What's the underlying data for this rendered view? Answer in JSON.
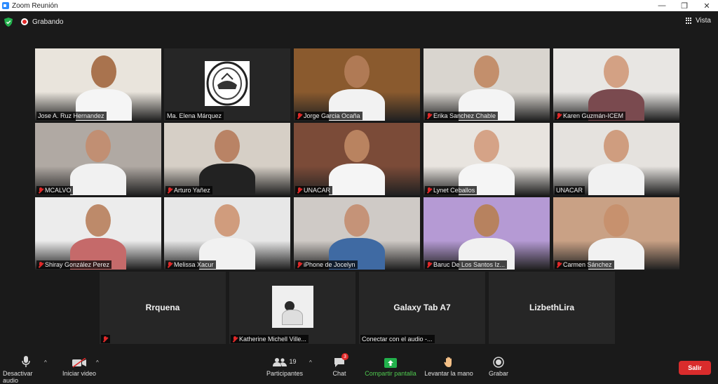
{
  "window": {
    "title": "Zoom Reunión",
    "minimize": "—",
    "maximize": "❐",
    "close": "✕"
  },
  "meeting": {
    "recording_label": "Grabando",
    "view_label": "Vista"
  },
  "participants": [
    {
      "name": "Jose A. Ruz Hernandez",
      "muted": false,
      "bg": "#e9e4dc",
      "skin": "#a9734e",
      "shirt": "#f5f5f5"
    },
    {
      "name": "Ma. Elena Márquez",
      "muted": false,
      "bg": "#262626",
      "skin": "#ffffff",
      "shirt": "#ffffff"
    },
    {
      "name": "Jorge Garcia Ocaña",
      "muted": true,
      "bg": "#8a5a2e",
      "skin": "#b07a55",
      "shirt": "#f2f2f2"
    },
    {
      "name": "Erika Sanchez Chable",
      "muted": true,
      "bg": "#d9d5cf",
      "skin": "#c38f6c",
      "shirt": "#f4f4f4"
    },
    {
      "name": "Karen Guzmán-ICEM",
      "muted": true,
      "bg": "#e8e6e3",
      "skin": "#d3a184",
      "shirt": "#7a4a4f"
    },
    {
      "name": "MCALVO",
      "muted": true,
      "bg": "#b0a9a3",
      "skin": "#c18f73",
      "shirt": "#f1f1f1"
    },
    {
      "name": "Arturo Yañez",
      "muted": true,
      "bg": "#d6cfc6",
      "skin": "#b98365",
      "shirt": "#222222"
    },
    {
      "name": "UNACAR",
      "muted": true,
      "bg": "#7b4b38",
      "skin": "#b98360",
      "shirt": "#f5f5f5"
    },
    {
      "name": "Lynet Ceballos",
      "muted": true,
      "bg": "#e8e4df",
      "skin": "#d5a387",
      "shirt": "#f5f5f5"
    },
    {
      "name": "UNACAR",
      "muted": false,
      "bg": "#e5e2de",
      "skin": "#cf9d7f",
      "shirt": "#f1f1f1"
    },
    {
      "name": "Shiray González Perez",
      "muted": true,
      "bg": "#ececec",
      "skin": "#bd8a6a",
      "shirt": "#c56a6a"
    },
    {
      "name": "Melissa Xacur",
      "muted": true,
      "bg": "#e7e7e7",
      "skin": "#d09c7d",
      "shirt": "#f1f1f1"
    },
    {
      "name": "iPhone de Jocelyn",
      "muted": true,
      "bg": "#cfcac6",
      "skin": "#c59378",
      "shirt": "#3f6aa3"
    },
    {
      "name": "Baruc De Los Santos Iz...",
      "muted": true,
      "bg": "#b59ad4",
      "skin": "#b7825f",
      "shirt": "#f1f1f1"
    },
    {
      "name": "Carmen Sánchez",
      "muted": true,
      "bg": "#c9a185",
      "skin": "#c7916e",
      "shirt": "#f1f1f1"
    }
  ],
  "bottom_tiles": [
    {
      "display": "Rrquena",
      "caption": "",
      "muted": true
    },
    {
      "display": "",
      "caption": "Katherine Michell Ville...",
      "muted": true
    },
    {
      "display": "Galaxy Tab A7",
      "caption": "Conectar con el audio -...",
      "muted": false
    },
    {
      "display": "LizbethLira",
      "caption": "",
      "muted": false
    }
  ],
  "toolbar": {
    "mute_label": "Desactivar audio",
    "video_label": "Iniciar video",
    "participants_label": "Participantes",
    "participants_count": "19",
    "chat_label": "Chat",
    "chat_badge": "3",
    "share_label": "Compartir pantalla",
    "raise_hand_label": "Levantar la mano",
    "record_label": "Grabar",
    "leave_label": "Salir"
  },
  "colors": {
    "active_speaker": "#b9e05a",
    "leave": "#d92c2c",
    "share": "#4fc94f",
    "recording": "#e02828"
  }
}
